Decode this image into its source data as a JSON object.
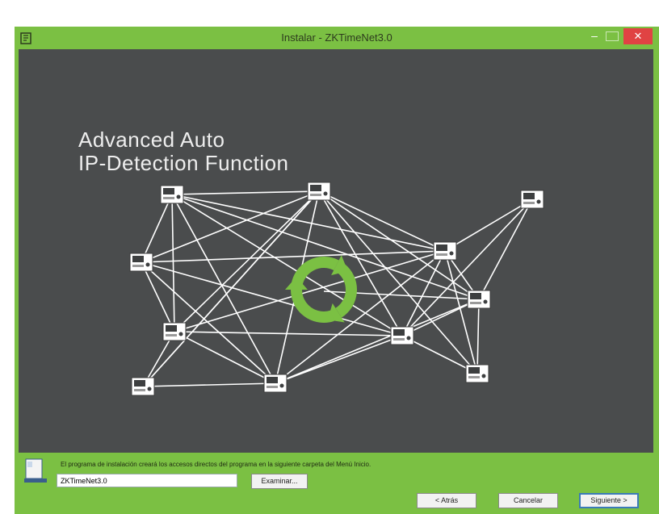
{
  "window": {
    "title": "Instalar - ZKTimeNet3.0",
    "accent_color": "#7bc043",
    "close_color": "#e04343",
    "icons": [
      "installer-icon",
      "minimize-icon",
      "maximize-icon",
      "close-icon"
    ]
  },
  "banner": {
    "line1": "Advanced Auto",
    "line2": "IP-Detection Function",
    "background": "#4a4c4d",
    "refresh_color": "#7bc043"
  },
  "footer": {
    "info_text": "El programa de instalación creará los accesos directos del programa en la siguiente carpeta del Menú Inicio.",
    "folder_value": "ZKTimeNet3.0",
    "browse_label": "Examinar...",
    "back_label": "< Atrás",
    "cancel_label": "Cancelar",
    "next_label": "Siguiente >"
  }
}
